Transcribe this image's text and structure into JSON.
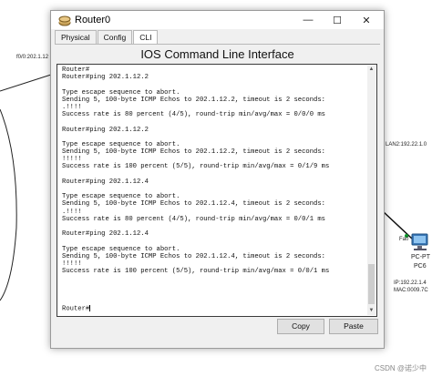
{
  "background": {
    "interface_label_left": "f0/0:202.1.12",
    "lan_label": "LAN2:192.22.1.0",
    "port_label": "Fa0",
    "pc_type": "PC-PT",
    "pc_name": "PC6",
    "pc_ip": "IP:192.22.1.4",
    "pc_mac": "MAC:0009.7C",
    "watermark": "CSDN @诺少中"
  },
  "window": {
    "title": "Router0",
    "minimize_symbol": "—",
    "maximize_symbol": "☐",
    "close_symbol": "✕"
  },
  "tabs": [
    {
      "label": "Physical"
    },
    {
      "label": "Config"
    },
    {
      "label": "CLI"
    }
  ],
  "heading": "IOS Command Line Interface",
  "console": {
    "lines": [
      "Router#",
      "Router#ping 202.1.12.2",
      "",
      "Type escape sequence to abort.",
      "Sending 5, 100-byte ICMP Echos to 202.1.12.2, timeout is 2 seconds:",
      ".!!!!",
      "Success rate is 80 percent (4/5), round-trip min/avg/max = 0/0/0 ms",
      "",
      "Router#ping 202.1.12.2",
      "",
      "Type escape sequence to abort.",
      "Sending 5, 100-byte ICMP Echos to 202.1.12.2, timeout is 2 seconds:",
      "!!!!!",
      "Success rate is 100 percent (5/5), round-trip min/avg/max = 0/1/9 ms",
      "",
      "Router#ping 202.1.12.4",
      "",
      "Type escape sequence to abort.",
      "Sending 5, 100-byte ICMP Echos to 202.1.12.4, timeout is 2 seconds:",
      ".!!!!",
      "Success rate is 80 percent (4/5), round-trip min/avg/max = 0/0/1 ms",
      "",
      "Router#ping 202.1.12.4",
      "",
      "Type escape sequence to abort.",
      "Sending 5, 100-byte ICMP Echos to 202.1.12.4, timeout is 2 seconds:",
      "!!!!!",
      "Success rate is 100 percent (5/5), round-trip min/avg/max = 0/0/1 ms",
      "",
      "",
      "",
      "",
      "Router#"
    ]
  },
  "buttons": {
    "copy": "Copy",
    "paste": "Paste"
  },
  "icons": {
    "app": "router-icon",
    "pc": "pc-icon",
    "scroll_up": "▲",
    "scroll_down": "▼"
  }
}
